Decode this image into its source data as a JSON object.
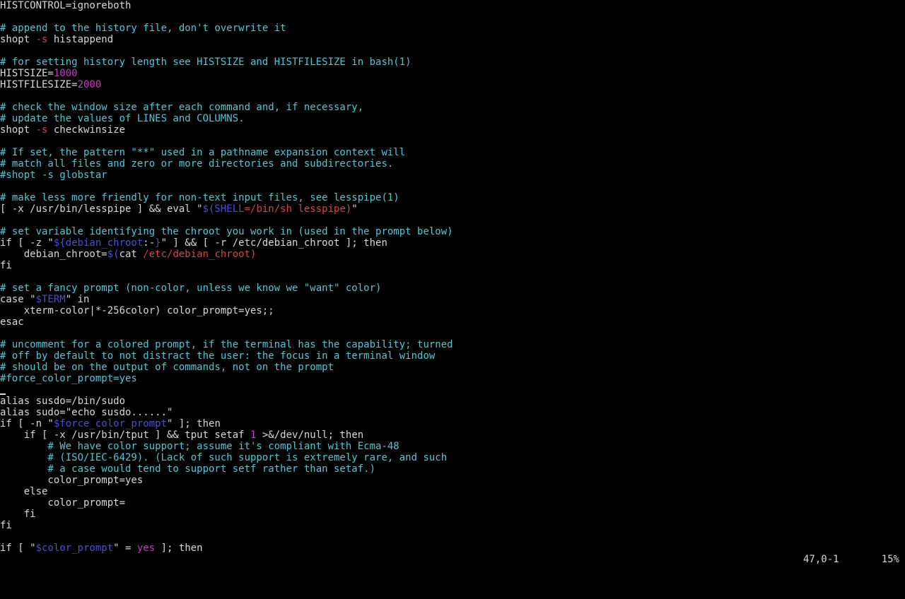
{
  "editor": {
    "lines": [
      [
        {
          "t": "HISTCONTROL=ignoreboth",
          "c": "txt"
        }
      ],
      [],
      [
        {
          "t": "# append to the history file, don't overwrite it",
          "c": "cmt"
        }
      ],
      [
        {
          "t": "shopt ",
          "c": "txt"
        },
        {
          "t": "-s",
          "c": "str"
        },
        {
          "t": " histappend",
          "c": "txt"
        }
      ],
      [],
      [
        {
          "t": "# for setting history length see HISTSIZE and HISTFILESIZE in bash(1)",
          "c": "cmt"
        }
      ],
      [
        {
          "t": "HISTSIZE=",
          "c": "txt"
        },
        {
          "t": "1000",
          "c": "num"
        }
      ],
      [
        {
          "t": "HISTFILESIZE=",
          "c": "txt"
        },
        {
          "t": "2000",
          "c": "num"
        }
      ],
      [],
      [
        {
          "t": "# check the window size after each command and, if necessary,",
          "c": "cmt"
        }
      ],
      [
        {
          "t": "# update the values of LINES and COLUMNS.",
          "c": "cmt"
        }
      ],
      [
        {
          "t": "shopt ",
          "c": "txt"
        },
        {
          "t": "-s",
          "c": "str"
        },
        {
          "t": " checkwinsize",
          "c": "txt"
        }
      ],
      [],
      [
        {
          "t": "# If set, the pattern \"**\" used in a pathname expansion context will",
          "c": "cmt"
        }
      ],
      [
        {
          "t": "# match all files and zero or more directories and subdirectories.",
          "c": "cmt"
        }
      ],
      [
        {
          "t": "#shopt -s globstar",
          "c": "cmt"
        }
      ],
      [],
      [
        {
          "t": "# make less more friendly for non-text input files, see lesspipe(1)",
          "c": "cmt"
        }
      ],
      [
        {
          "t": "[ -x /usr/bin/lesspipe ] && eval \"",
          "c": "txt"
        },
        {
          "t": "$(SHELL",
          "c": "var"
        },
        {
          "t": "=/bin/sh lesspipe)",
          "c": "str"
        },
        {
          "t": "\"",
          "c": "txt"
        }
      ],
      [],
      [
        {
          "t": "# set variable identifying the chroot you work in (used in the prompt below)",
          "c": "cmt"
        }
      ],
      [
        {
          "t": "if [ -z \"",
          "c": "txt"
        },
        {
          "t": "${debian_chroot",
          "c": "var"
        },
        {
          "t": ":-",
          "c": "txt"
        },
        {
          "t": "}",
          "c": "var"
        },
        {
          "t": "\" ] && [ -r /etc/debian_chroot ]; then",
          "c": "txt"
        }
      ],
      [
        {
          "t": "    debian_chroot=",
          "c": "txt"
        },
        {
          "t": "$(",
          "c": "var"
        },
        {
          "t": "cat ",
          "c": "txt"
        },
        {
          "t": "/etc/debian_chroot)",
          "c": "str"
        }
      ],
      [
        {
          "t": "fi",
          "c": "txt"
        }
      ],
      [],
      [
        {
          "t": "# set a fancy prompt (non-color, unless we know we \"want\" color)",
          "c": "cmt"
        }
      ],
      [
        {
          "t": "case \"",
          "c": "txt"
        },
        {
          "t": "$TERM",
          "c": "var"
        },
        {
          "t": "\" in",
          "c": "txt"
        }
      ],
      [
        {
          "t": "    xterm-color|*-256color) color_prompt=yes;;",
          "c": "txt"
        }
      ],
      [
        {
          "t": "esac",
          "c": "txt"
        }
      ],
      [],
      [
        {
          "t": "# uncomment for a colored prompt, if the terminal has the capability; turned",
          "c": "cmt"
        }
      ],
      [
        {
          "t": "# off by default to not distract the user: the focus in a terminal window",
          "c": "cmt"
        }
      ],
      [
        {
          "t": "# should be on the output of commands, not on the prompt",
          "c": "cmt"
        }
      ],
      [
        {
          "t": "#force_color_prompt=yes",
          "c": "cmt"
        }
      ],
      [
        {
          "t": "",
          "c": "cursor"
        }
      ],
      [
        {
          "t": "alias susdo=/bin/sudo",
          "c": "txt"
        }
      ],
      [
        {
          "t": "alias sudo=\"echo susdo......\"",
          "c": "txt"
        }
      ],
      [
        {
          "t": "if [ -n \"",
          "c": "txt"
        },
        {
          "t": "$force_color_prompt",
          "c": "var"
        },
        {
          "t": "\" ]; then",
          "c": "txt"
        }
      ],
      [
        {
          "t": "    if [ -x /usr/bin/tput ] && tput setaf ",
          "c": "txt"
        },
        {
          "t": "1",
          "c": "num"
        },
        {
          "t": " >&/dev/null; then",
          "c": "txt"
        }
      ],
      [
        {
          "t": "        # We have color support; assume it's compliant with Ecma-48",
          "c": "cmt"
        }
      ],
      [
        {
          "t": "        # (ISO/IEC-6429). (Lack of such support is extremely rare, and such",
          "c": "cmt"
        }
      ],
      [
        {
          "t": "        # a case would tend to support setf rather than setaf.)",
          "c": "cmt"
        }
      ],
      [
        {
          "t": "        color_prompt=yes",
          "c": "txt"
        }
      ],
      [
        {
          "t": "    else",
          "c": "txt"
        }
      ],
      [
        {
          "t": "        color_prompt=",
          "c": "txt"
        }
      ],
      [
        {
          "t": "    fi",
          "c": "txt"
        }
      ],
      [
        {
          "t": "fi",
          "c": "txt"
        }
      ],
      [],
      [
        {
          "t": "if [ \"",
          "c": "txt"
        },
        {
          "t": "$color_prompt",
          "c": "var"
        },
        {
          "t": "\" = ",
          "c": "txt"
        },
        {
          "t": "yes",
          "c": "num"
        },
        {
          "t": " ]; then",
          "c": "txt"
        }
      ]
    ]
  },
  "status": {
    "ruler": "47,0-1",
    "scroll": "15%"
  },
  "colors": {
    "background": "#000000",
    "text": "#d8d8d8",
    "comment": "#4ec9d4",
    "string": "#d44545",
    "variable": "#4b4fd6",
    "number": "#c73bc7"
  }
}
